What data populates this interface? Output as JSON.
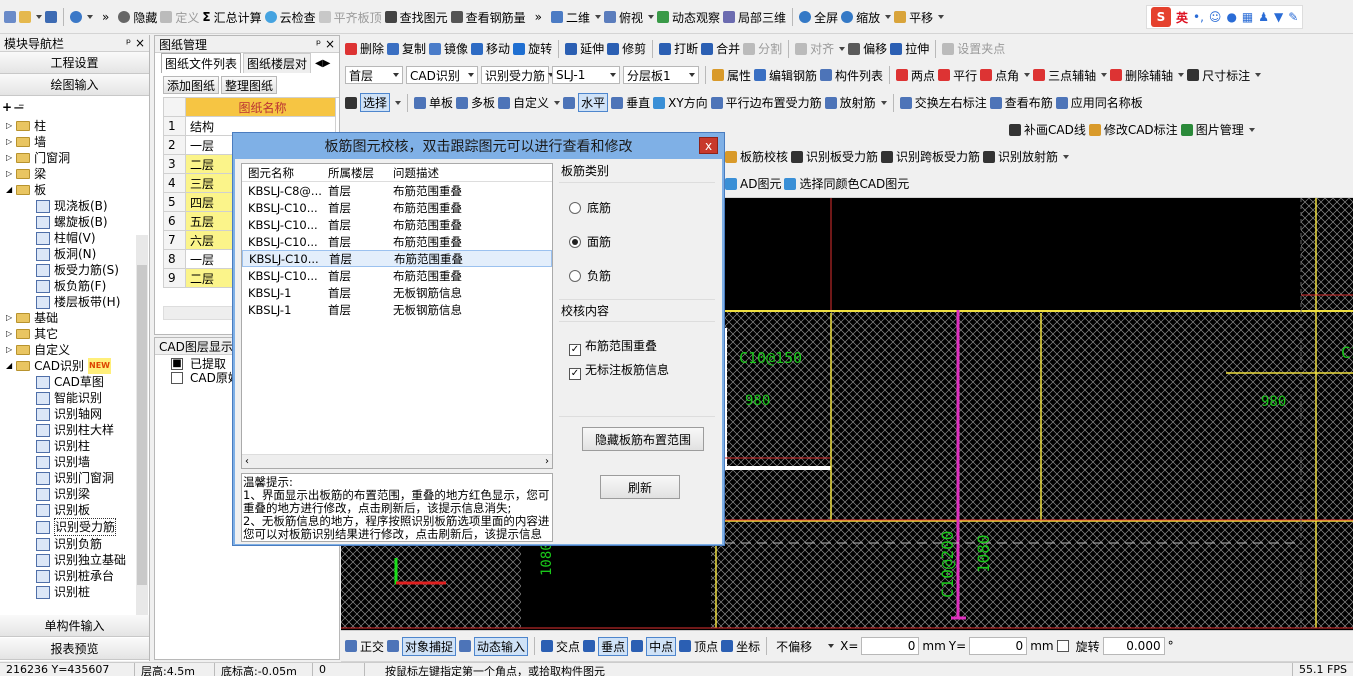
{
  "toolbar1": {
    "items": [
      "隐藏",
      "定义",
      "汇总计算",
      "云检查",
      "平齐板顶",
      "查找图元",
      "查看钢筋量",
      "二维",
      "俯视",
      "动态观察",
      "局部三维",
      "全屏",
      "缩放",
      "平移"
    ],
    "ime": "英"
  },
  "nav": {
    "title": "模块导航栏",
    "buttons": [
      "工程设置",
      "绘图输入"
    ],
    "tree": [
      "柱",
      "墙",
      "门窗洞",
      "梁",
      "板",
      "现浇板(B)",
      "螺旋板(B)",
      "柱帽(V)",
      "板洞(N)",
      "板受力筋(S)",
      "板负筋(F)",
      "楼层板带(H)",
      "基础",
      "其它",
      "自定义",
      "CAD识别",
      "CAD草图",
      "智能识别",
      "识别轴网",
      "识别柱大样",
      "识别柱",
      "识别墙",
      "识别门窗洞",
      "识别梁",
      "识别板",
      "识别受力筋",
      "识别负筋",
      "识别独立基础",
      "识别桩承台",
      "识别桩"
    ],
    "new_badge": "NEW",
    "bottom": [
      "单构件输入",
      "报表预览"
    ]
  },
  "drawing": {
    "title": "图纸管理",
    "tabs": [
      "图纸文件列表",
      "图纸楼层对"
    ],
    "buttons": [
      "添加图纸",
      "整理图纸"
    ],
    "column": "图纸名称",
    "rows": [
      [
        "1",
        "结构"
      ],
      [
        "2",
        "一层"
      ],
      [
        "3",
        "二层"
      ],
      [
        "4",
        "三层"
      ],
      [
        "5",
        "四层"
      ],
      [
        "6",
        "五层"
      ],
      [
        "7",
        "六层"
      ],
      [
        "8",
        "一层"
      ],
      [
        "9",
        "二层"
      ]
    ]
  },
  "cad_layers": {
    "title": "CAD图层显示",
    "items": [
      "已提取",
      "CAD原始"
    ]
  },
  "toolbar2": {
    "items": [
      "删除",
      "复制",
      "镜像",
      "移动",
      "旋转",
      "延伸",
      "修剪",
      "打断",
      "合并",
      "分割",
      "对齐",
      "偏移",
      "拉伸",
      "设置夹点"
    ]
  },
  "toolbar3": {
    "floor": "首层",
    "mode": "CAD识别",
    "type": "识别受力筋",
    "name": "SLJ-1",
    "layer": "分层板1",
    "items": [
      "属性",
      "编辑钢筋",
      "构件列表",
      "两点",
      "平行",
      "点角",
      "三点辅轴",
      "删除辅轴",
      "尺寸标注"
    ]
  },
  "toolbar4": {
    "items": [
      "选择",
      "单板",
      "多板",
      "自定义",
      "水平",
      "垂直",
      "XY方向",
      "平行边布置受力筋",
      "放射筋",
      "交换左右标注",
      "查看布筋",
      "应用同名称板"
    ]
  },
  "toolbar5": {
    "items": [
      "补画CAD线",
      "修改CAD标注",
      "图片管理"
    ]
  },
  "toolbar6": {
    "items": [
      "板筋校核",
      "识别板受力筋",
      "识别跨板受力筋",
      "识别放射筋"
    ]
  },
  "toolbar7": {
    "items": [
      "AD图元",
      "选择同颜色CAD图元"
    ]
  },
  "dialog": {
    "title": "板筋图元校核，双击跟踪图元可以进行查看和修改",
    "close": "x",
    "columns": [
      "图元名称",
      "所属楼层",
      "问题描述"
    ],
    "rows": [
      [
        "KBSLJ-C8@...",
        "首层",
        "布筋范围重叠"
      ],
      [
        "KBSLJ-C10...",
        "首层",
        "布筋范围重叠"
      ],
      [
        "KBSLJ-C10...",
        "首层",
        "布筋范围重叠"
      ],
      [
        "KBSLJ-C10...",
        "首层",
        "布筋范围重叠"
      ],
      [
        "KBSLJ-C10...",
        "首层",
        "布筋范围重叠"
      ],
      [
        "KBSLJ-C10...",
        "首层",
        "布筋范围重叠"
      ],
      [
        "KBSLJ-1",
        "首层",
        "无板钢筋信息"
      ],
      [
        "KBSLJ-1",
        "首层",
        "无板钢筋信息"
      ]
    ],
    "selected_row": 4,
    "category_label": "板筋类别",
    "radios": [
      "底筋",
      "面筋",
      "负筋"
    ],
    "radio_selected": 1,
    "check_label": "校核内容",
    "checks": [
      "布筋范围重叠",
      "无标注板筋信息"
    ],
    "hide_button": "隐藏板筋布置范围",
    "refresh_button": "刷新",
    "tips": [
      "温馨提示:",
      "1、界面显示出板筋的布置范围，重叠的地方红色显示，您可",
      "重叠的地方进行修改，点击刷新后，该提示信息消失;",
      "2、无板筋信息的地方，程序按照识别板筋选项里面的内容进",
      "您可以对板筋识别结果进行修改，点击刷新后，该提示信息"
    ]
  },
  "canvas": {
    "labels": [
      "C10@200",
      "1080",
      "1080",
      "C1",
      "C10@150",
      "980",
      "980"
    ]
  },
  "snapbar": {
    "items": [
      "正交",
      "对象捕捉",
      "动态输入",
      "交点",
      "垂点",
      "中点",
      "顶点",
      "坐标"
    ],
    "offset": "不偏移",
    "x_label": "X=",
    "x_value": "0",
    "unit": "mm",
    "y_label": "Y=",
    "y_value": "0",
    "rotate_label": "旋转",
    "rotate_value": "0.000",
    "deg": "°"
  },
  "status": {
    "coords": "216236 Y=435607",
    "floor_h": "层高:4.5m",
    "bottom_h": "底标高:-0.05m",
    "zero": "0",
    "hint": "按鼠标左键指定第一个角点，或拾取构件图元",
    "fps": "55.1 FPS"
  }
}
